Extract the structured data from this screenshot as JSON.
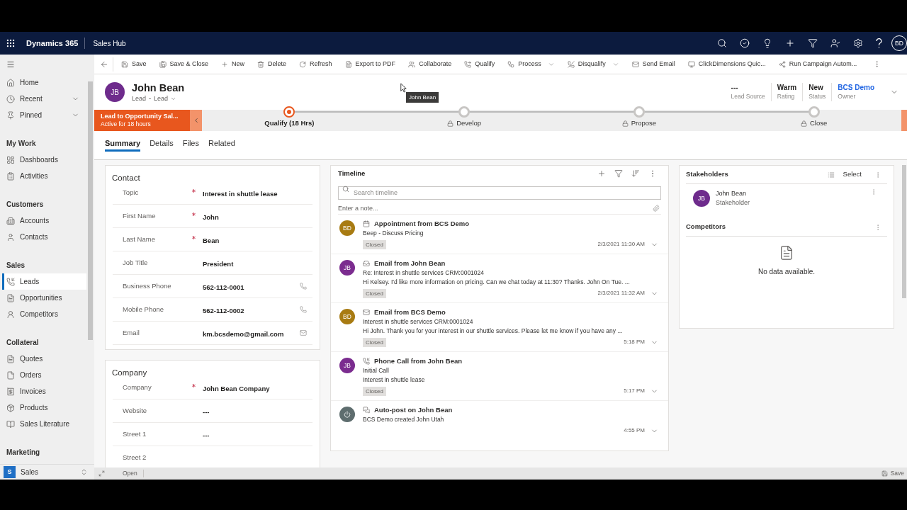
{
  "top_bar": {
    "app_name": "Dynamics 365",
    "area_name": "Sales Hub",
    "user_initials": "BD"
  },
  "sidebar": {
    "top_items": [
      {
        "label": "Home"
      },
      {
        "label": "Recent",
        "expanded": false
      },
      {
        "label": "Pinned",
        "expanded": false
      }
    ],
    "groups": [
      {
        "heading": "My Work",
        "items": [
          {
            "label": "Dashboards",
            "selected": false
          },
          {
            "label": "Activities",
            "selected": false
          }
        ]
      },
      {
        "heading": "Customers",
        "items": [
          {
            "label": "Accounts",
            "selected": false
          },
          {
            "label": "Contacts",
            "selected": false
          }
        ]
      },
      {
        "heading": "Sales",
        "items": [
          {
            "label": "Leads",
            "selected": true
          },
          {
            "label": "Opportunities",
            "selected": false
          },
          {
            "label": "Competitors",
            "selected": false
          }
        ]
      },
      {
        "heading": "Collateral",
        "items": [
          {
            "label": "Quotes",
            "selected": false
          },
          {
            "label": "Orders",
            "selected": false
          },
          {
            "label": "Invoices",
            "selected": false
          },
          {
            "label": "Products",
            "selected": false
          },
          {
            "label": "Sales Literature",
            "selected": false
          }
        ]
      },
      {
        "heading": "Marketing"
      }
    ],
    "area_switcher": {
      "badge": "S",
      "label": "Sales"
    }
  },
  "command_bar": {
    "commands": [
      {
        "label": "Save",
        "kind": "button"
      },
      {
        "label": "Save & Close",
        "kind": "button"
      },
      {
        "label": "New",
        "kind": "button"
      },
      {
        "label": "Delete",
        "kind": "button"
      },
      {
        "label": "Refresh",
        "kind": "button"
      },
      {
        "label": "Export to PDF",
        "kind": "button"
      },
      {
        "label": "Collaborate",
        "kind": "button"
      },
      {
        "label": "Qualify",
        "kind": "button"
      },
      {
        "label": "Process",
        "kind": "menu"
      },
      {
        "label": "Disqualify",
        "kind": "menu"
      },
      {
        "label": "Send Email",
        "kind": "button"
      },
      {
        "label": "ClickDimensions Quic...",
        "kind": "button"
      },
      {
        "label": "Run Campaign Autom...",
        "kind": "button"
      }
    ]
  },
  "header": {
    "initials": "JB",
    "title": "John Bean",
    "entity": "Lead",
    "form": "Lead",
    "fields": [
      {
        "value": "---",
        "label": "Lead Source",
        "kind": "text"
      },
      {
        "value": "Warm",
        "label": "Rating",
        "kind": "text"
      },
      {
        "value": "New",
        "label": "Status",
        "kind": "text"
      },
      {
        "value": "BCS Demo",
        "label": "Owner",
        "kind": "link"
      }
    ],
    "tooltip": "John Bean"
  },
  "process_bar": {
    "name": "Lead to Opportunity Sal...",
    "duration": "Active for 18 hours",
    "stages": [
      {
        "label": "Qualify (18 Hrs)",
        "selected": true,
        "locked": false
      },
      {
        "label": "Develop",
        "selected": false,
        "locked": true
      },
      {
        "label": "Propose",
        "selected": false,
        "locked": true
      },
      {
        "label": "Close",
        "selected": false,
        "locked": true
      }
    ]
  },
  "tabs": [
    {
      "label": "Summary",
      "selected": true
    },
    {
      "label": "Details",
      "selected": false
    },
    {
      "label": "Files",
      "selected": false
    },
    {
      "label": "Related",
      "selected": false
    }
  ],
  "sections": [
    {
      "title": "Contact",
      "fields": [
        {
          "label": "Topic",
          "required": true,
          "value": "Interest in shuttle lease",
          "kind": "text"
        },
        {
          "label": "First Name",
          "required": true,
          "value": "John",
          "kind": "text"
        },
        {
          "label": "Last Name",
          "required": true,
          "value": "Bean",
          "kind": "text"
        },
        {
          "label": "Job Title",
          "required": false,
          "value": "President",
          "kind": "text"
        },
        {
          "label": "Business Phone",
          "required": false,
          "value": "562-112-0001",
          "kind": "phone"
        },
        {
          "label": "Mobile Phone",
          "required": false,
          "value": "562-112-0002",
          "kind": "phone"
        },
        {
          "label": "Email",
          "required": false,
          "value": "km.bcsdemo@gmail.com",
          "kind": "email"
        }
      ]
    },
    {
      "title": "Company",
      "fields": [
        {
          "label": "Company",
          "required": true,
          "value": "John Bean Company",
          "kind": "text"
        },
        {
          "label": "Website",
          "required": false,
          "value": "---",
          "kind": "text"
        },
        {
          "label": "Street 1",
          "required": false,
          "value": "---",
          "kind": "text"
        },
        {
          "label": "Street 2",
          "required": false,
          "kind": "text"
        }
      ]
    }
  ],
  "timeline": {
    "title": "Timeline",
    "search_placeholder": "Search timeline",
    "note_placeholder": "Enter a note...",
    "items": [
      {
        "kind": "appointment",
        "initials": "BD",
        "color": "#a87b12",
        "title": "Appointment from BCS Demo",
        "lines": [
          "Beep - Discuss Pricing"
        ],
        "status": "Closed",
        "time": "2/3/2021 11:30 AM"
      },
      {
        "kind": "email_received",
        "initials": "JB",
        "color": "#7b2c8f",
        "title": "Email from John Bean",
        "lines": [
          "Re: Interest in shuttle services CRM:0001024",
          "Hi Kelsey. I'd like more information on pricing. Can we chat today at 11:30? Thanks. John On Tue. ..."
        ],
        "status": "Closed",
        "time": "2/3/2021 11:32 AM"
      },
      {
        "kind": "email_sent",
        "initials": "BD",
        "color": "#a87b12",
        "title": "Email from BCS Demo",
        "lines": [
          "Interest in shuttle services CRM:0001024",
          "Hi John. Thank you for your interest in our shuttle services. Please let me know if you have any ..."
        ],
        "status": "Closed",
        "time": "5:18 PM"
      },
      {
        "kind": "phone_call",
        "initials": "JB",
        "color": "#7b2c8f",
        "title": "Phone Call from John Bean",
        "lines": [
          "Initial Call",
          "Interest in shuttle lease"
        ],
        "status": "Closed",
        "time": "5:17 PM"
      },
      {
        "kind": "post",
        "color": "#5e6d6e",
        "title": "Auto-post on John Bean",
        "lines": [
          "BCS Demo created John Utah"
        ],
        "time": "4:55 PM"
      }
    ]
  },
  "stakeholders": {
    "title": "Stakeholders",
    "action": "Select",
    "items": [
      {
        "initials": "JB",
        "name": "John Bean",
        "role": "Stakeholder"
      }
    ]
  },
  "competitors": {
    "title": "Competitors",
    "empty_text": "No data available."
  },
  "status_bar": {
    "status": "Open",
    "save_label": "Save"
  }
}
